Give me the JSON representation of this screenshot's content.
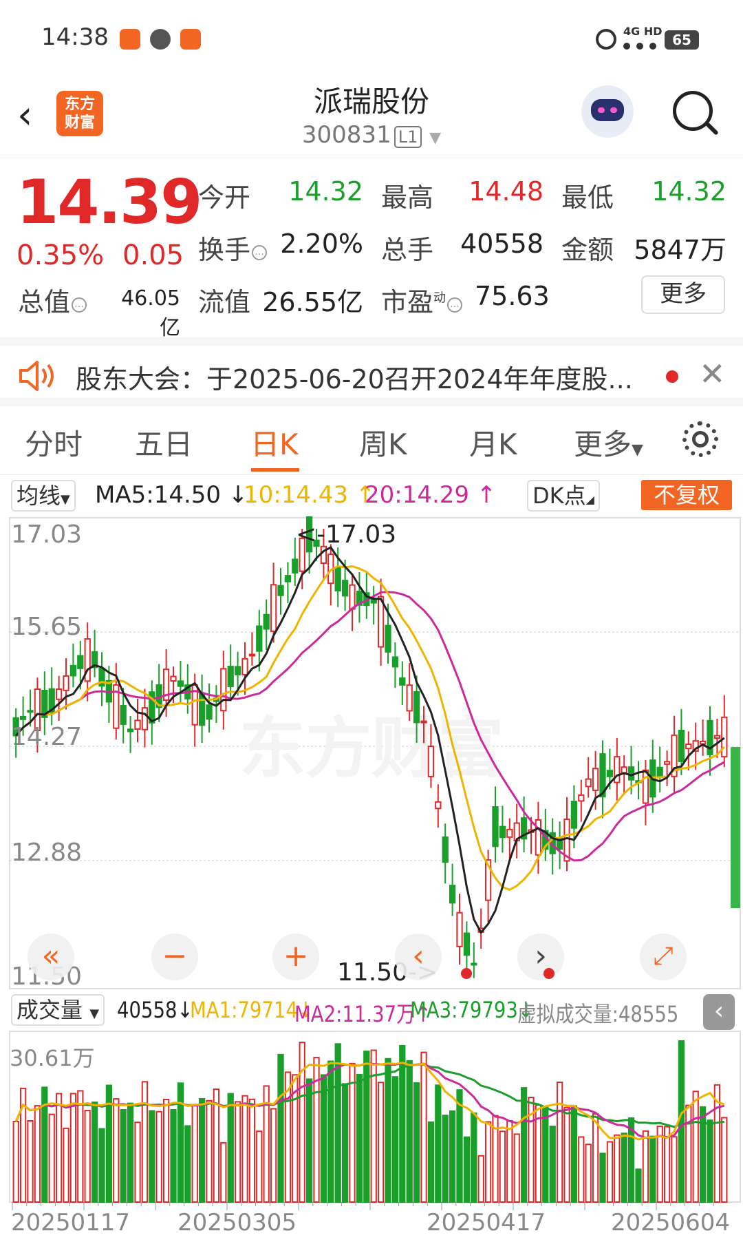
{
  "status_bar": {
    "time": "14:38",
    "network": "4G HD",
    "battery": "65"
  },
  "header": {
    "logo_line1": "东方",
    "logo_line2": "财富",
    "stock_name": "派瑞股份",
    "stock_code": "300831",
    "level": "L1"
  },
  "quote": {
    "price": "14.39",
    "change_pct": "0.35%",
    "change": "0.05",
    "open_label": "今开",
    "open": "14.32",
    "high_label": "最高",
    "high": "14.48",
    "low_label": "最低",
    "low": "14.32",
    "turnover_label": "换手",
    "turnover": "2.20%",
    "volume_label": "总手",
    "volume": "40558",
    "amount_label": "金额",
    "amount": "5847万",
    "mktcap_label": "总值",
    "mktcap": "46.05亿",
    "float_label": "流值",
    "float_cap": "26.55亿",
    "pe_label": "市盈",
    "pe_sup": "动",
    "pe": "75.63",
    "more_label": "更多"
  },
  "notice": {
    "text": "股东大会：于2025-06-20召开2024年年度股..."
  },
  "tabs": [
    "分时",
    "五日",
    "日K",
    "周K",
    "月K",
    "更多"
  ],
  "active_tab": "日K",
  "ma_bar": {
    "selector": "均线",
    "ma5": "MA5:14.50 ↓",
    "ma10": "10:14.43 ↑",
    "ma20": "20:14.29 ↑",
    "dk": "DK点",
    "adjust": "不复权"
  },
  "kline": {
    "y_labels": [
      "17.03",
      "15.65",
      "14.27",
      "12.88",
      "11.50"
    ],
    "max_annotation": "<-17.03",
    "min_annotation": "11.50->",
    "watermark": "东方财富"
  },
  "volume_bar": {
    "selector": "成交量",
    "vol": "40558↓",
    "ma1": "MA1:79714↓",
    "ma2": "MA2:11.37万↑",
    "ma3": "MA3:79793↓",
    "virtual": "虚拟成交量:48555",
    "y_label": "30.61万"
  },
  "x_dates": [
    "20250117",
    "20250305",
    "20250417",
    "20250604"
  ],
  "colors": {
    "up": "#e12828",
    "down": "#1a9f2b",
    "accent": "#f26522",
    "ma5": "#222222",
    "ma10": "#f0b400",
    "ma20": "#cc2a9c"
  }
}
